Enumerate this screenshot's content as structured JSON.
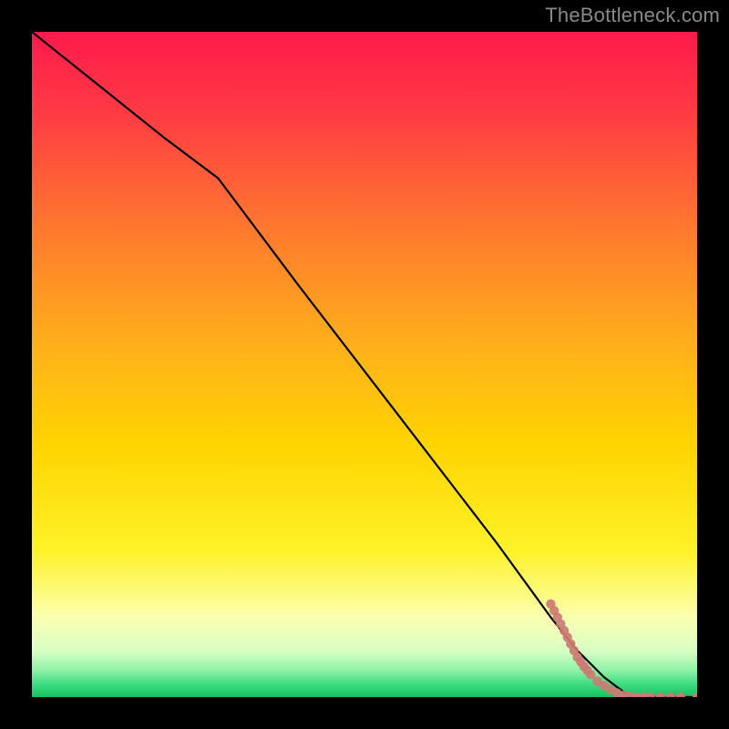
{
  "attribution": "TheBottleneck.com",
  "colors": {
    "bg_outer": "#000000",
    "line": "#000000",
    "marker": "#cc7b73",
    "gradient_top": "#ff1a4c",
    "gradient_mid": "#ffd400",
    "gradient_green": "#29d46f"
  },
  "chart_data": {
    "type": "line",
    "title": "",
    "xlabel": "",
    "ylabel": "",
    "xlim": [
      0,
      100
    ],
    "ylim": [
      0,
      100
    ],
    "series": [
      {
        "name": "bottleneck-curve",
        "x": [
          0,
          10,
          20,
          28,
          40,
          50,
          60,
          70,
          78,
          82,
          86,
          90,
          94,
          98,
          100
        ],
        "y": [
          100,
          92,
          84,
          78,
          62,
          49,
          36,
          23,
          12,
          7,
          3,
          0,
          0,
          0,
          0
        ]
      }
    ],
    "scatter": {
      "name": "sample-points",
      "points": [
        {
          "x": 78,
          "y": 14
        },
        {
          "x": 78.5,
          "y": 13
        },
        {
          "x": 79,
          "y": 12
        },
        {
          "x": 79.5,
          "y": 11
        },
        {
          "x": 80,
          "y": 10
        },
        {
          "x": 80.5,
          "y": 9
        },
        {
          "x": 81,
          "y": 8
        },
        {
          "x": 81.5,
          "y": 7
        },
        {
          "x": 82,
          "y": 6
        },
        {
          "x": 82.5,
          "y": 5.3
        },
        {
          "x": 83,
          "y": 4.6
        },
        {
          "x": 83.5,
          "y": 4
        },
        {
          "x": 84,
          "y": 3.4
        },
        {
          "x": 85,
          "y": 2.4
        },
        {
          "x": 86,
          "y": 1.7
        },
        {
          "x": 87,
          "y": 1.1
        },
        {
          "x": 88,
          "y": 0.6
        },
        {
          "x": 89,
          "y": 0.3
        },
        {
          "x": 90,
          "y": 0.1
        },
        {
          "x": 91,
          "y": 0
        },
        {
          "x": 92,
          "y": 0
        },
        {
          "x": 93,
          "y": 0
        },
        {
          "x": 94.5,
          "y": 0
        },
        {
          "x": 96,
          "y": 0
        },
        {
          "x": 97.5,
          "y": 0
        },
        {
          "x": 100,
          "y": 0
        }
      ]
    }
  }
}
